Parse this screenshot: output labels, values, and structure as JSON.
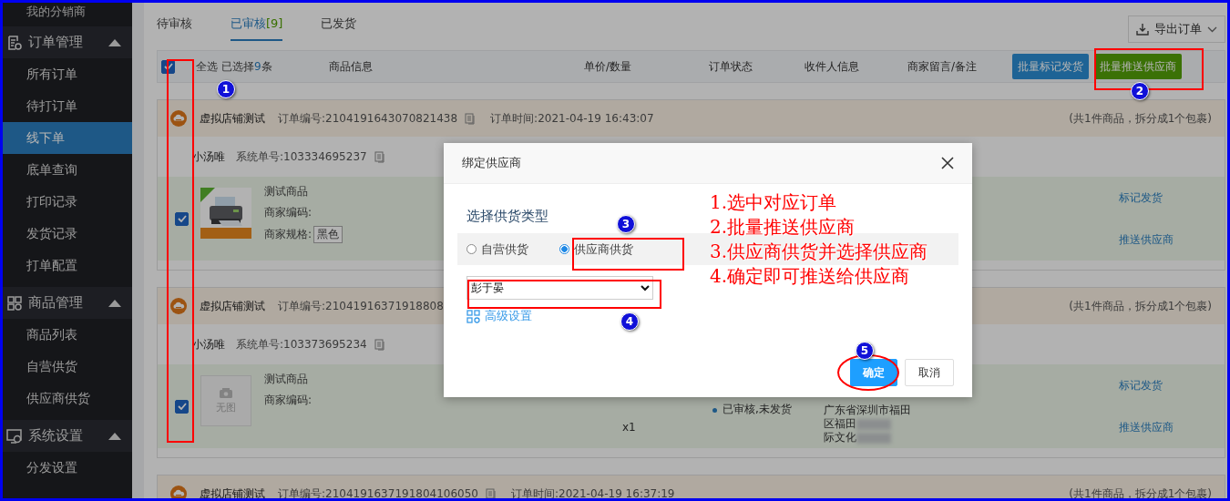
{
  "sidebar": {
    "partial_item": "我的分销商",
    "groups": [
      {
        "label": "订单管理",
        "expanded": true,
        "items": [
          {
            "label": "所有订单",
            "selected": false
          },
          {
            "label": "待打订单",
            "selected": false
          },
          {
            "label": "线下单",
            "selected": true
          },
          {
            "label": "底单查询",
            "selected": false
          },
          {
            "label": "打印记录",
            "selected": false
          },
          {
            "label": "发货记录",
            "selected": false
          },
          {
            "label": "打单配置",
            "selected": false
          }
        ]
      },
      {
        "label": "商品管理",
        "expanded": true,
        "items": [
          {
            "label": "商品列表",
            "selected": false
          },
          {
            "label": "自营供货",
            "selected": false
          },
          {
            "label": "供应商供货",
            "selected": false
          }
        ]
      },
      {
        "label": "系统设置",
        "expanded": true,
        "items": [
          {
            "label": "分发设置",
            "selected": false
          }
        ]
      }
    ]
  },
  "tabs": [
    {
      "label": "待审核",
      "selected": false
    },
    {
      "label": "已审核",
      "count": "[9]",
      "selected": true
    },
    {
      "label": "已发货",
      "selected": false
    }
  ],
  "export_button": {
    "label": "导出订单"
  },
  "table_header": {
    "select_all": {
      "label": "全选",
      "checked": true
    },
    "selection": {
      "prefix": "已选择",
      "count": "9",
      "suffix": "条"
    },
    "columns": [
      "商品信息",
      "单价/数量",
      "订单状态",
      "收件人信息",
      "商家留言/备注"
    ],
    "bulk_actions": [
      {
        "label": "批量标记发货",
        "kind": "primary"
      },
      {
        "label": "批量推送供应商",
        "kind": "success"
      }
    ]
  },
  "orders": [
    {
      "shop": "虚拟店铺测试",
      "order_no": "订单编号:2104191643070821438",
      "order_time": "订单时间:2021-04-19 16:43:07",
      "summary": "(共1件商品，拆分成1个包裹)",
      "buyer": "小汤唯",
      "system_no": "系统单号:103334695237",
      "product": {
        "checked": true,
        "title": "测试商品",
        "fields": [
          {
            "label": "商家编码:"
          },
          {
            "label": "商家规格:",
            "tag": "黑色"
          }
        ]
      },
      "actions": [
        "标记发货",
        "推送供应商"
      ]
    },
    {
      "shop": "虚拟店铺测试",
      "order_no": "订单编号:21041916371918808",
      "summary": "(共1件商品，拆分成1个包裹)",
      "buyer": "小汤唯",
      "system_no": "系统单号:103373695234",
      "product": {
        "checked": true,
        "thumbnail": {
          "kind": "none",
          "label": "无图"
        },
        "title": "测试商品",
        "fields": [
          {
            "label": "商家编码:"
          }
        ]
      },
      "quantity": "x1",
      "status": "已审核,未发货",
      "address_lines": [
        {
          "text": "广东省深圳市福田",
          "redacted": false
        },
        {
          "text": "区福田",
          "redacted": true
        },
        {
          "text": "际文化",
          "redacted": true
        }
      ],
      "actions": [
        "标记发货",
        "推送供应商"
      ]
    },
    {
      "shop": "虚拟店铺测试",
      "order_no": "订单编号:2104191637191804106050",
      "order_time": "订单时间:2021-04-19 16:37:19",
      "summary": "(共1件商品，拆分成1个包裹)"
    }
  ],
  "dialog": {
    "title": "绑定供应商",
    "section_title": "选择供货类型",
    "options": [
      {
        "label": "自营供货",
        "selected": false
      },
      {
        "label": "供应商供货",
        "selected": true
      }
    ],
    "supplier_select": {
      "value": "彭于晏"
    },
    "advanced_link": "高级设置",
    "buttons": [
      {
        "label": "确定",
        "kind": "primary"
      },
      {
        "label": "取消",
        "kind": "default"
      }
    ]
  },
  "annotations": {
    "steps": [
      "1.选中对应订单",
      "2.批量推送供应商",
      "3.供应商供货并选择供应商",
      "4.确定即可推送给供应商"
    ],
    "markers": [
      "1",
      "2",
      "3",
      "4",
      "5"
    ]
  }
}
